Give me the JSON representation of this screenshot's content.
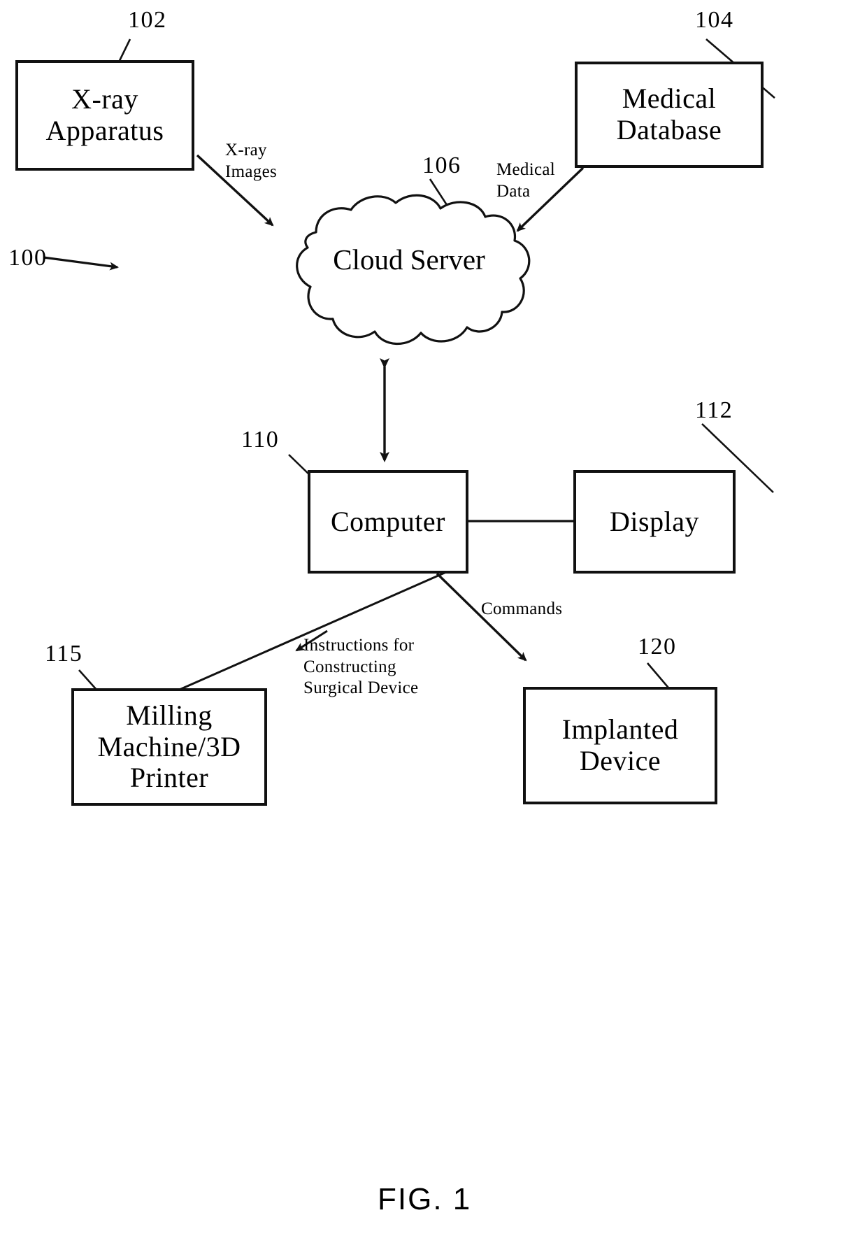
{
  "figure": {
    "caption": "FIG. 1",
    "system_ref": "100"
  },
  "nodes": [
    {
      "id": "xray-apparatus",
      "ref": "102",
      "lines": [
        "X-ray",
        "Apparatus"
      ]
    },
    {
      "id": "medical-database",
      "ref": "104",
      "lines": [
        "Medical",
        "Database"
      ]
    },
    {
      "id": "cloud-server",
      "ref": "106",
      "lines": [
        "Cloud",
        "Server"
      ]
    },
    {
      "id": "computer",
      "ref": "110",
      "lines": [
        "Computer"
      ]
    },
    {
      "id": "display",
      "ref": "112",
      "lines": [
        "Display"
      ]
    },
    {
      "id": "milling-machine",
      "ref": "115",
      "lines": [
        "Milling",
        "Machine/3D",
        "Printer"
      ]
    },
    {
      "id": "implanted-device",
      "ref": "120",
      "lines": [
        "Implanted",
        "Device"
      ]
    }
  ],
  "edge_labels": {
    "xray_images": [
      "X-ray",
      "Images"
    ],
    "medical_data": [
      "Medical",
      "Data"
    ],
    "commands": [
      "Commands"
    ],
    "instructions": [
      "Instructions for",
      "Constructing",
      "Surgical Device"
    ]
  },
  "colors": {
    "stroke": "#111111",
    "background": "#ffffff"
  }
}
